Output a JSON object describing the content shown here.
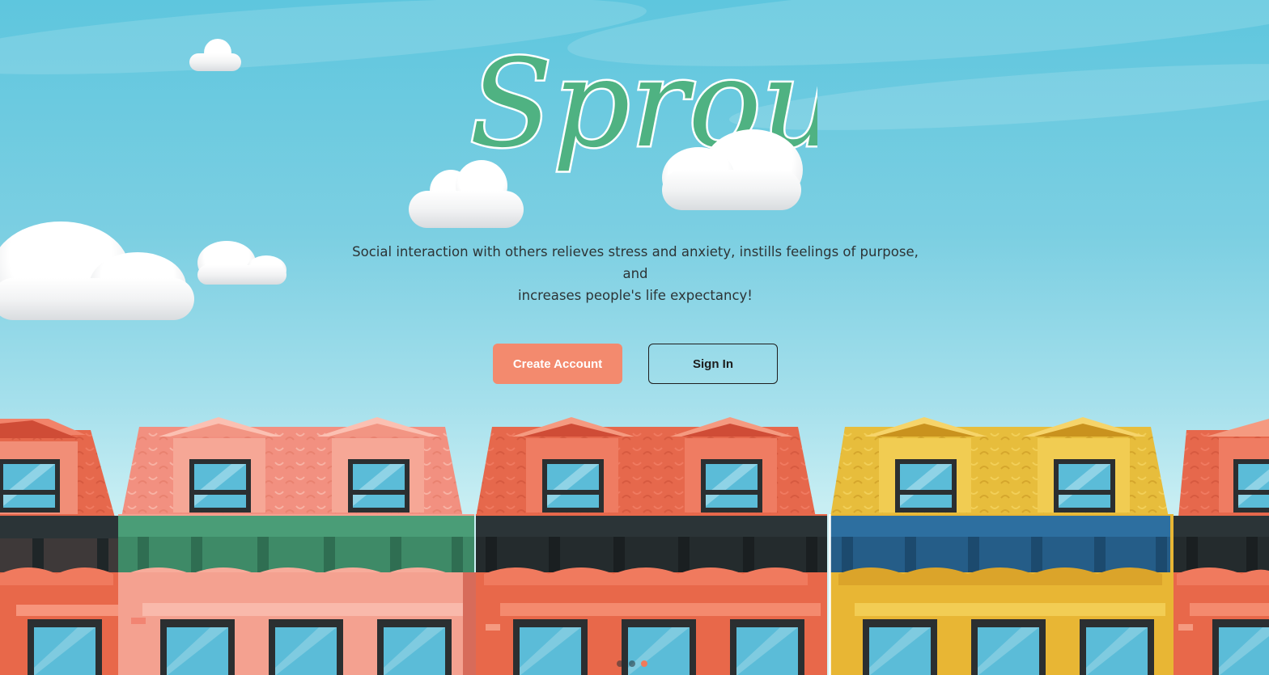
{
  "brand": {
    "logo_text": "Sprout",
    "logo_color": "#4fb282"
  },
  "hero": {
    "tagline_line1": "Social interaction with others relieves stress and anxiety, instills feelings of purpose, and",
    "tagline_line2": "increases people's life expectancy!"
  },
  "actions": {
    "create_account_label": "Create Account",
    "sign_in_label": "Sign In",
    "primary_color": "#f38a6e"
  },
  "carousel": {
    "slide_count": 3,
    "active_index": 2
  },
  "colors": {
    "house_orange": "#e8684a",
    "house_pink": "#f4a190",
    "house_yellow": "#e8b634",
    "awning_green": "#4a9d77",
    "awning_blue": "#2d6fa0",
    "awning_dark": "#2d3436",
    "window_glass": "#5bbcd8"
  }
}
